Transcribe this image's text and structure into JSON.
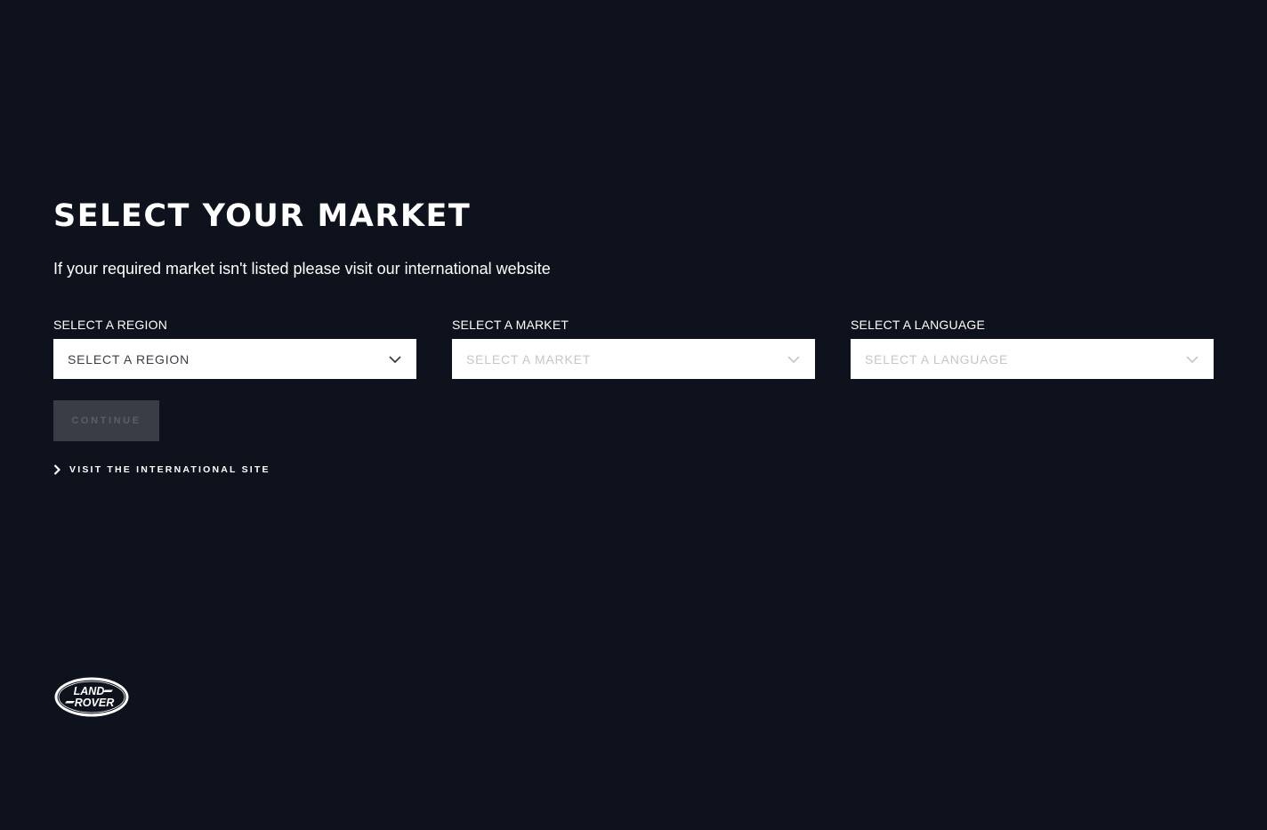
{
  "page": {
    "title": "SELECT YOUR MARKET",
    "subtitle": "If your required market isn't listed please visit our international website"
  },
  "fields": {
    "region": {
      "label": "SELECT A REGION",
      "value": "SELECT A REGION"
    },
    "market": {
      "label": "SELECT A MARKET",
      "value": "SELECT A MARKET"
    },
    "language": {
      "label": "SELECT A LANGUAGE",
      "value": "SELECT A LANGUAGE"
    }
  },
  "actions": {
    "continue_label": "CONTINUE",
    "international_link": "VISIT THE INTERNATIONAL SITE"
  },
  "logo": {
    "name": "land-rover-logo",
    "line1": "LAND",
    "line2": "ROVER"
  },
  "colors": {
    "background": "#0e121c",
    "select_bg": "#ffffff",
    "button_disabled_bg": "#3a3d46",
    "text": "#ffffff"
  },
  "icons": {
    "dropdown": "chevron-down-icon",
    "link": "chevron-right-icon"
  }
}
